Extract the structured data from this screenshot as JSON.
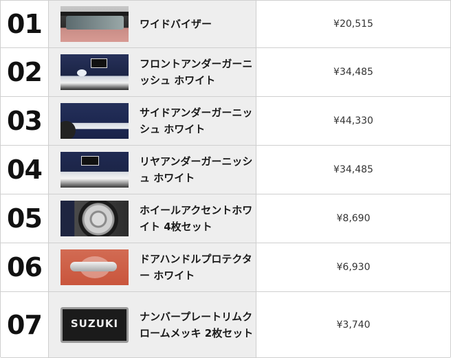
{
  "rows": [
    {
      "number": "01",
      "name": "ワイドバイザー",
      "price": "¥20,515"
    },
    {
      "number": "02",
      "name": "フロントアンダーガーニッシュ ホワイト",
      "price": "¥34,485"
    },
    {
      "number": "03",
      "name": "サイドアンダーガーニッシュ ホワイト",
      "price": "¥44,330"
    },
    {
      "number": "04",
      "name": "リヤアンダーガーニッシュ ホワイト",
      "price": "¥34,485"
    },
    {
      "number": "05",
      "name": "ホイールアクセントホワイト 4枚セット",
      "price": "¥8,690"
    },
    {
      "number": "06",
      "name": "ドアハンドルプロテクター ホワイト",
      "price": "¥6,930"
    },
    {
      "number": "07",
      "name": "ナンバープレートリムクロームメッキ 2枚セット",
      "price": "¥3,740"
    }
  ],
  "plate_logo_text": "SUZUKI"
}
